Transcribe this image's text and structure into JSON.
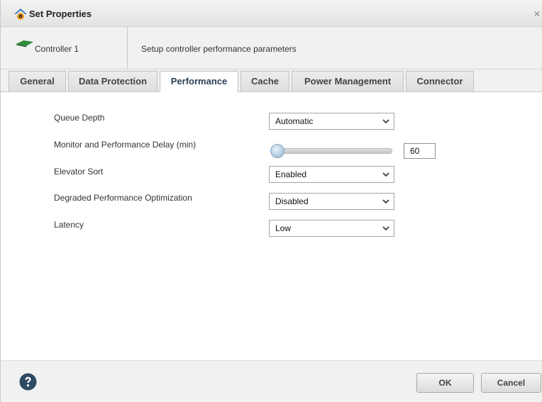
{
  "window": {
    "title": "Set Properties",
    "close_glyph": "×",
    "title_icon": "gear-house-icon"
  },
  "header": {
    "controller_label": "Controller 1",
    "controller_icon": "controller-card-icon",
    "description": "Setup controller performance parameters"
  },
  "tabs": [
    {
      "label": "General",
      "active": false
    },
    {
      "label": "Data Protection",
      "active": false
    },
    {
      "label": "Performance",
      "active": true
    },
    {
      "label": "Cache",
      "active": false
    },
    {
      "label": "Power Management",
      "active": false
    },
    {
      "label": "Connector",
      "active": false
    }
  ],
  "fields": {
    "queue_depth": {
      "label": "Queue Depth",
      "value": "Automatic"
    },
    "monitor_delay": {
      "label": "Monitor and Performance Delay (min)",
      "value": "60",
      "slider_fraction": 0.0
    },
    "elevator_sort": {
      "label": "Elevator Sort",
      "value": "Enabled"
    },
    "degraded_opt": {
      "label": "Degraded Performance Optimization",
      "value": "Disabled"
    },
    "latency": {
      "label": "Latency",
      "value": "Low"
    }
  },
  "footer": {
    "help_icon": "help-icon",
    "ok_label": "OK",
    "cancel_label": "Cancel"
  },
  "colors": {
    "active_tab_text": "#2a3f55",
    "help_icon_bg": "#2f4a64",
    "controller_icon": "#2e8b3a"
  }
}
